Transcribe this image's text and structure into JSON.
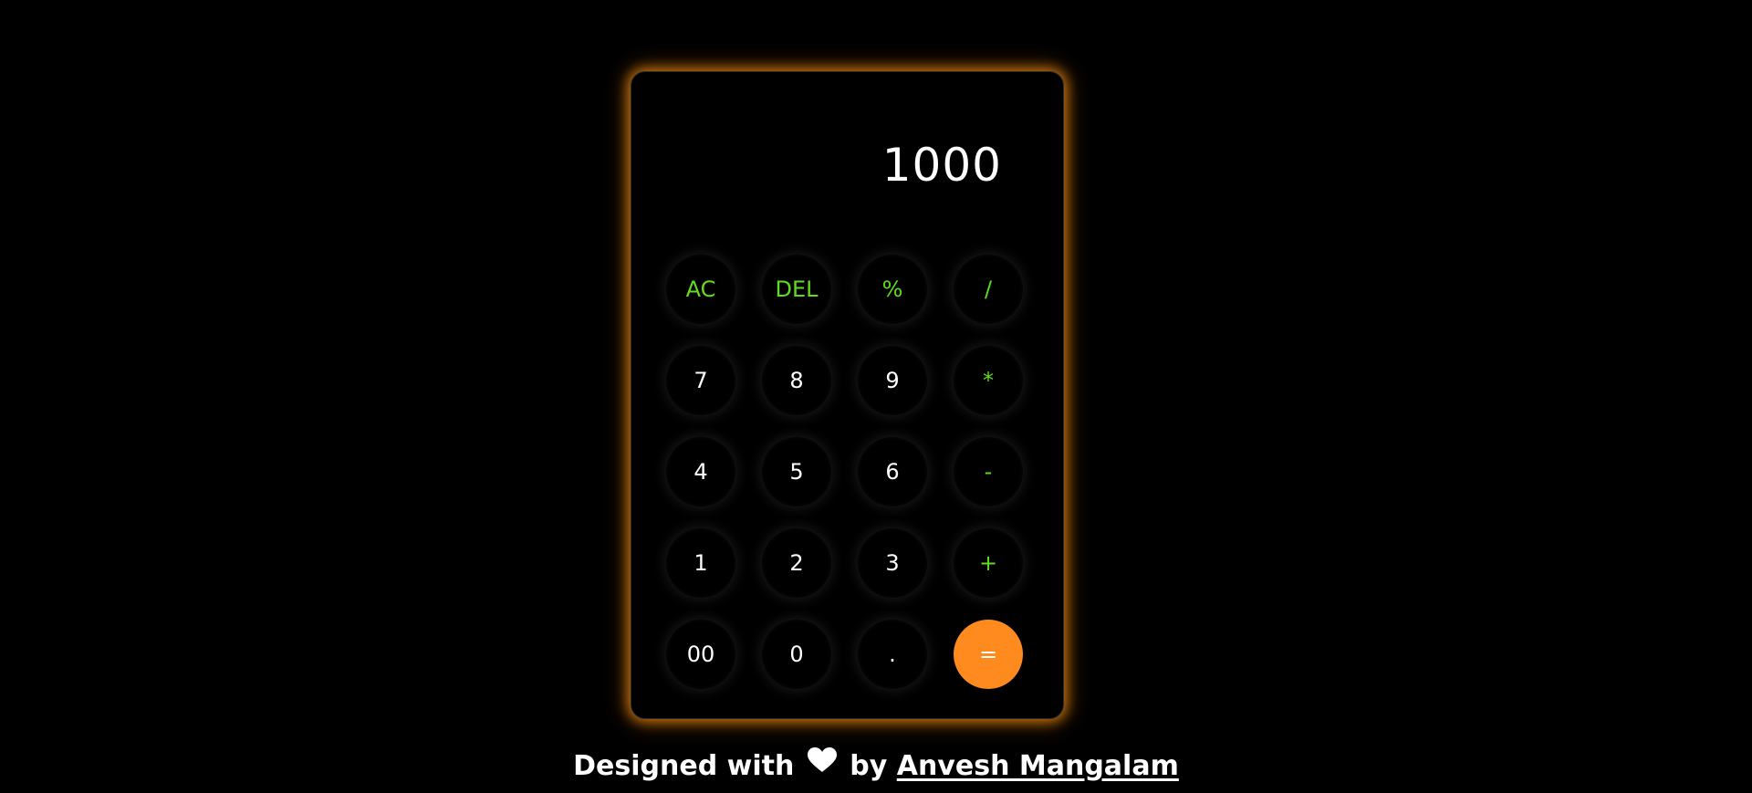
{
  "display": {
    "value": "1000"
  },
  "keys": [
    {
      "label": "AC",
      "type": "op",
      "name": "ac-button"
    },
    {
      "label": "DEL",
      "type": "op",
      "name": "delete-button"
    },
    {
      "label": "%",
      "type": "op",
      "name": "percent-button"
    },
    {
      "label": "/",
      "type": "op",
      "name": "divide-button"
    },
    {
      "label": "7",
      "type": "num",
      "name": "digit-7-button"
    },
    {
      "label": "8",
      "type": "num",
      "name": "digit-8-button"
    },
    {
      "label": "9",
      "type": "num",
      "name": "digit-9-button"
    },
    {
      "label": "*",
      "type": "op",
      "name": "multiply-button"
    },
    {
      "label": "4",
      "type": "num",
      "name": "digit-4-button"
    },
    {
      "label": "5",
      "type": "num",
      "name": "digit-5-button"
    },
    {
      "label": "6",
      "type": "num",
      "name": "digit-6-button"
    },
    {
      "label": "-",
      "type": "op",
      "name": "subtract-button"
    },
    {
      "label": "1",
      "type": "num",
      "name": "digit-1-button"
    },
    {
      "label": "2",
      "type": "num",
      "name": "digit-2-button"
    },
    {
      "label": "3",
      "type": "num",
      "name": "digit-3-button"
    },
    {
      "label": "+",
      "type": "op",
      "name": "add-button"
    },
    {
      "label": "00",
      "type": "num",
      "name": "double-zero-button"
    },
    {
      "label": "0",
      "type": "num",
      "name": "digit-0-button"
    },
    {
      "label": ".",
      "type": "num",
      "name": "decimal-point-button"
    },
    {
      "label": "=",
      "type": "equals",
      "name": "equals-button"
    }
  ],
  "footer": {
    "prefix": "Designed with",
    "heart_icon": "heart-icon",
    "middle": "by",
    "author": "Anvesh Mangalam"
  },
  "colors": {
    "operator": "#5fdc1f",
    "equals": "#ff8a1e",
    "glow": "#ff9614"
  }
}
